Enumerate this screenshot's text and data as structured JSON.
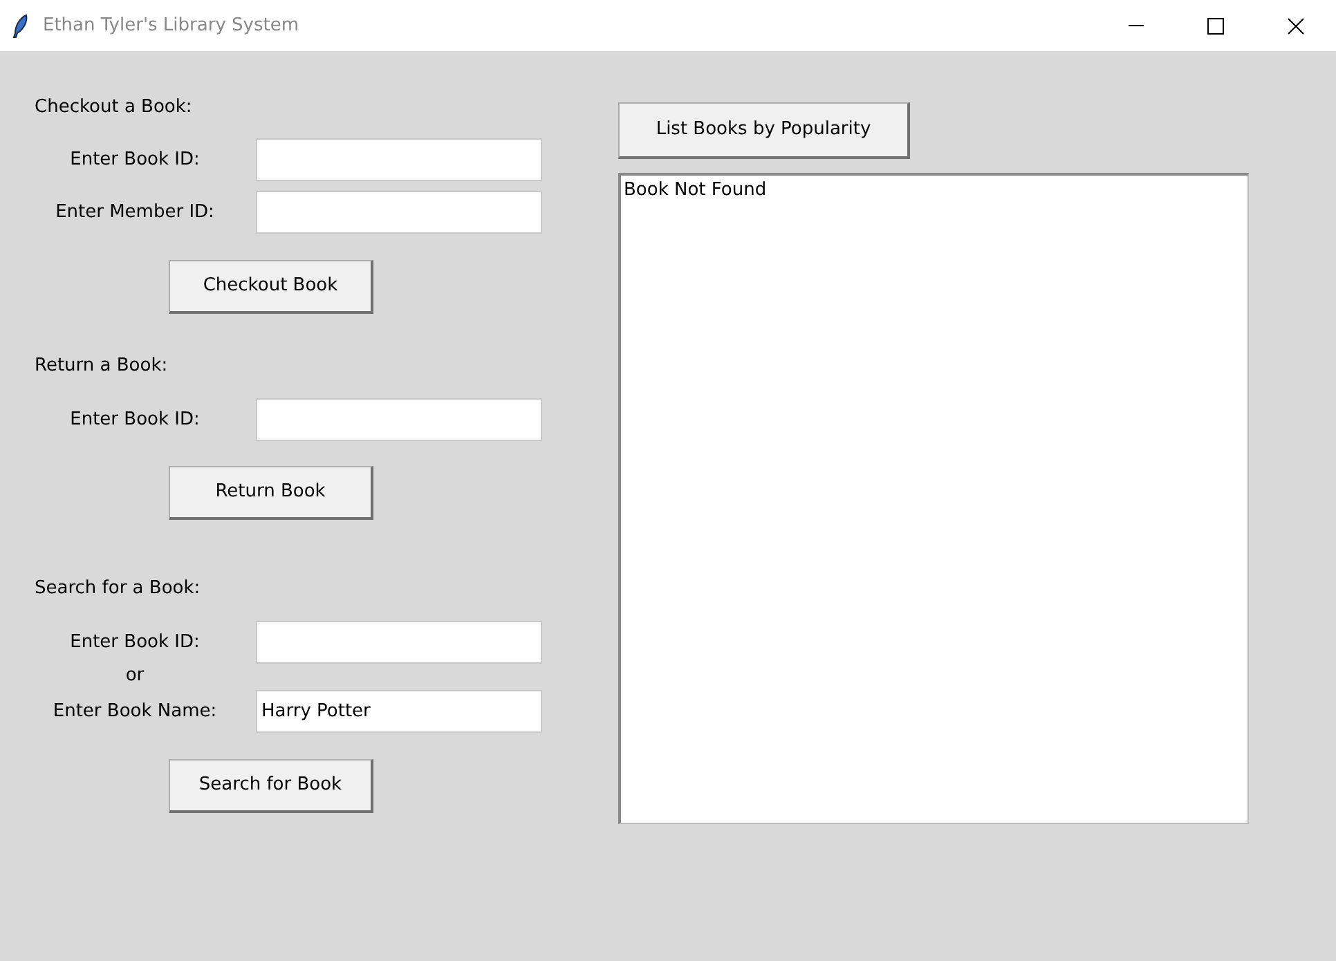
{
  "window": {
    "title": "Ethan Tyler's Library System"
  },
  "sections": [
    {
      "heading": "Checkout a Book:",
      "rows": [
        {
          "kind": "field",
          "label": "Enter Book ID:"
        },
        {
          "kind": "field",
          "label": "Enter Member ID:"
        }
      ],
      "button": "Checkout Book"
    },
    {
      "heading": "Return a Book:",
      "rows": [
        {
          "kind": "field",
          "label": "Enter Book ID:"
        }
      ],
      "button": "Return Book"
    },
    {
      "heading": "Search for a Book:",
      "rows": [
        {
          "kind": "field",
          "label": "Enter Book ID:"
        },
        {
          "kind": "separator",
          "label": "or"
        },
        {
          "kind": "field",
          "label": "Enter Book Name:",
          "value": "Harry Potter"
        }
      ],
      "button": "Search for Book"
    }
  ],
  "popularity_button": "List Books by Popularity",
  "results": [
    "Book Not Found"
  ]
}
